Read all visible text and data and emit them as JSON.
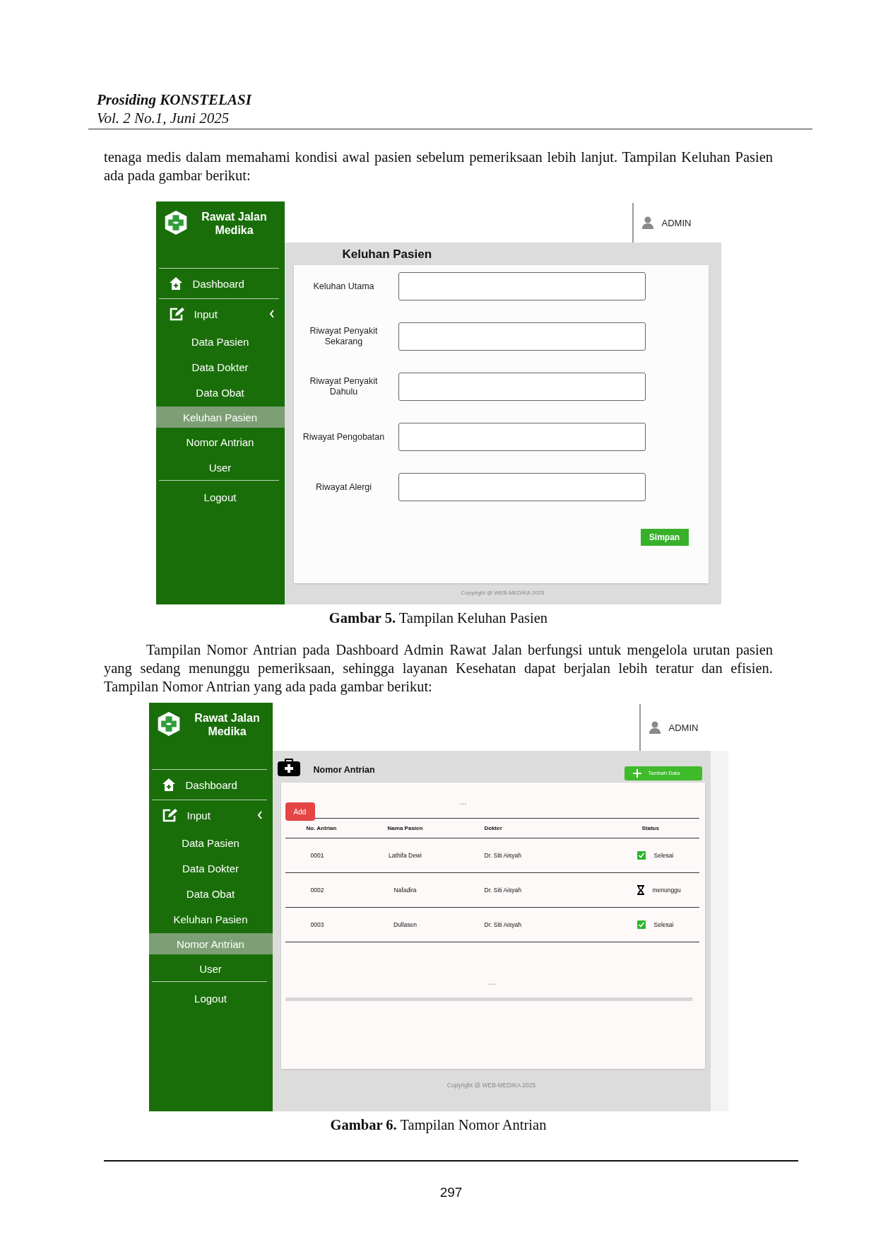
{
  "header": {
    "journal": "Prosiding KONSTELASI",
    "issue": "Vol. 2 No.1, Juni 2025"
  },
  "blocks": [
    {
      "kind": "paragraph",
      "indent": false,
      "text": "tenaga medis dalam memahami kondisi awal pasien sebelum pemeriksaan lebih lanjut. Tampilan Keluhan Pasien ada pada gambar berikut:"
    },
    {
      "kind": "figure",
      "caption": "**Gambar 5.** Tampilan Keluhan Pasien",
      "app": {
        "kind": "form",
        "brand": "Rawat Jalan Medika",
        "user": "ADMIN",
        "title": "Keluhan Pasien",
        "nav": [
          {
            "kind": "dashboard",
            "label": "Dashboard",
            "selected": false
          },
          {
            "kind": "menu",
            "label": "Input",
            "selected": false
          },
          {
            "kind": "sub",
            "label": "Data Pasien",
            "selected": false
          },
          {
            "kind": "sub",
            "label": "Data Dokter",
            "selected": false
          },
          {
            "kind": "sub",
            "label": "Data Obat",
            "selected": false
          },
          {
            "kind": "sub",
            "label": "Keluhan Pasien",
            "selected": true
          },
          {
            "kind": "sub",
            "label": "Nomor Antrian",
            "selected": false
          },
          {
            "kind": "sub",
            "label": "User",
            "selected": false
          },
          {
            "kind": "logout",
            "label": "Logout",
            "selected": false
          }
        ],
        "fields": [
          {
            "label": "Keluhan Utama"
          },
          {
            "label": "Riwayat Penyakit Sekarang"
          },
          {
            "label": "Riwayat Penyakit Dahulu"
          },
          {
            "label": "Riwayat Pengobatan"
          },
          {
            "label": "Riwayat Alergi"
          }
        ],
        "save_button": "Simpan",
        "footer": "Copyright @ WEB-MEDIKA 2025"
      }
    },
    {
      "kind": "paragraph",
      "indent": true,
      "text": "Tampilan Nomor Antrian pada Dashboard Admin Rawat Jalan berfungsi untuk mengelola urutan pasien yang sedang menunggu pemeriksaan, sehingga layanan Kesehatan dapat berjalan lebih teratur dan efisien. Tampilan Nomor Antrian yang ada pada gambar berikut:"
    },
    {
      "kind": "figure",
      "caption": "**Gambar 6.** Tampilan Nomor Antrian",
      "app": {
        "kind": "table",
        "brand": "Rawat Jalan Medika",
        "user": "ADMIN",
        "title": "Nomor Antrian",
        "nav": [
          {
            "kind": "dashboard",
            "label": "Dashboard",
            "selected": false
          },
          {
            "kind": "menu",
            "label": "Input",
            "selected": false
          },
          {
            "kind": "sub",
            "label": "Data Pasien",
            "selected": false
          },
          {
            "kind": "sub",
            "label": "Data Dokter",
            "selected": false
          },
          {
            "kind": "sub",
            "label": "Data Obat",
            "selected": false
          },
          {
            "kind": "sub",
            "label": "Keluhan Pasien",
            "selected": false
          },
          {
            "kind": "sub",
            "label": "Nomor Antrian",
            "selected": true
          },
          {
            "kind": "sub",
            "label": "User",
            "selected": false
          },
          {
            "kind": "logout",
            "label": "Logout",
            "selected": false
          }
        ],
        "add_data_button": "Tambah Data",
        "add_button": "Add",
        "more_top": "...",
        "columns": [
          "No. Antrian",
          "Nama Pasien",
          "Dokter",
          "Status"
        ],
        "rows": [
          {
            "cells": [
              "0001",
              "Lathifa Dewi",
              "Dr. Siti Aisyah"
            ],
            "status": {
              "kind": "done",
              "text": "Selesai"
            }
          },
          {
            "cells": [
              "0002",
              "Nafadira",
              "Dr. Siti Aisyah"
            ],
            "status": {
              "kind": "waiting",
              "text": "menunggu"
            }
          },
          {
            "cells": [
              "0003",
              "Dullasen",
              "Dr. Siti Aisyah"
            ],
            "status": {
              "kind": "done",
              "text": "Selesai"
            }
          }
        ],
        "more_bottom": "...",
        "footer": "Copyright @ WEB-MEDIKA 2025"
      }
    }
  ],
  "page_number": "297"
}
